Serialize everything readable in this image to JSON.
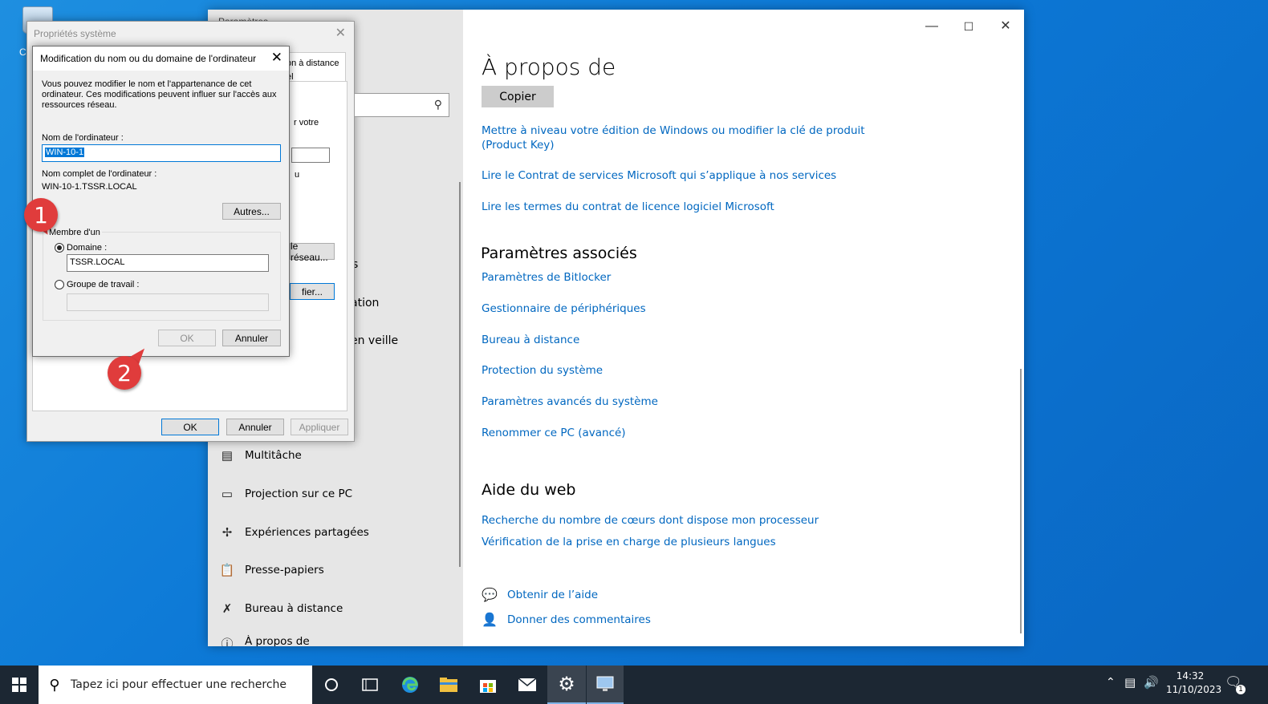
{
  "desktop": {
    "partial_label": "C"
  },
  "settings": {
    "window_title_partial": "Paramètres",
    "minimize": "—",
    "maximize": "☐",
    "close": "✕",
    "heading": "À propos de",
    "copy_button": "Copier",
    "links_top": [
      "Mettre à niveau votre édition de Windows ou modifier la clé de produit",
      "(Product Key)",
      "Lire le Contrat de services Microsoft qui s’applique à nos services",
      "Lire les termes du contrat de licence logiciel Microsoft"
    ],
    "related_heading": "Paramètres associés",
    "related_links": [
      "Paramètres de Bitlocker",
      "Gestionnaire de périphériques",
      "Bureau à distance",
      "Protection du système",
      "Paramètres avancés du système",
      "Renommer ce PC (avancé)"
    ],
    "web_help_heading": "Aide du web",
    "web_help_links": [
      "Recherche du nombre de cœurs dont dispose mon processeur",
      "Vérification de la prise en charge de plusieurs langues"
    ],
    "get_help": "Obtenir de l’aide",
    "feedback": "Donner des commentaires",
    "nav": {
      "fragments": [
        "s",
        "ation",
        "en veille"
      ],
      "items": [
        {
          "label": "Multitâche",
          "icon": "multitask-icon"
        },
        {
          "label": "Projection sur ce PC",
          "icon": "projection-icon"
        },
        {
          "label": "Expériences partagées",
          "icon": "shared-experiences-icon"
        },
        {
          "label": "Presse-papiers",
          "icon": "clipboard-icon"
        },
        {
          "label": "Bureau à distance",
          "icon": "remote-desktop-icon"
        },
        {
          "label": "À propos de",
          "icon": "info-icon"
        }
      ]
    }
  },
  "sysprops": {
    "title": "Propriétés système",
    "close": "✕",
    "tab_partial_1": "on à distance",
    "tab_partial_2": "el",
    "frag_votre": "r votre",
    "frag_u": "u",
    "frag_reseau_btn": "le réseau...",
    "frag_modifier_btn": "fier...",
    "ok": "OK",
    "cancel": "Annuler",
    "apply": "Appliquer"
  },
  "rename": {
    "title": "Modification du nom ou du domaine de l'ordinateur",
    "close": "✕",
    "description_lines": [
      "Vous pouvez modifier le nom et l'appartenance de cet",
      "ordinateur. Ces modifications peuvent influer sur l'accès aux",
      "ressources réseau."
    ],
    "computer_name_label": "Nom de l'ordinateur :",
    "computer_name_value": "WIN-10-1",
    "full_name_label": "Nom complet de l'ordinateur :",
    "full_name_value": "WIN-10-1.TSSR.LOCAL",
    "more_button": "Autres...",
    "member_of_label": "Membre d'un",
    "domain_label": "Domaine :",
    "domain_value": "TSSR.LOCAL",
    "workgroup_label": "Groupe de travail :",
    "workgroup_value": "",
    "ok": "OK",
    "cancel": "Annuler"
  },
  "callouts": [
    "1",
    "2"
  ],
  "taskbar": {
    "search_placeholder": "Tapez ici pour effectuer une recherche",
    "time": "14:32",
    "date": "11/10/2023",
    "notification_count": "1"
  }
}
